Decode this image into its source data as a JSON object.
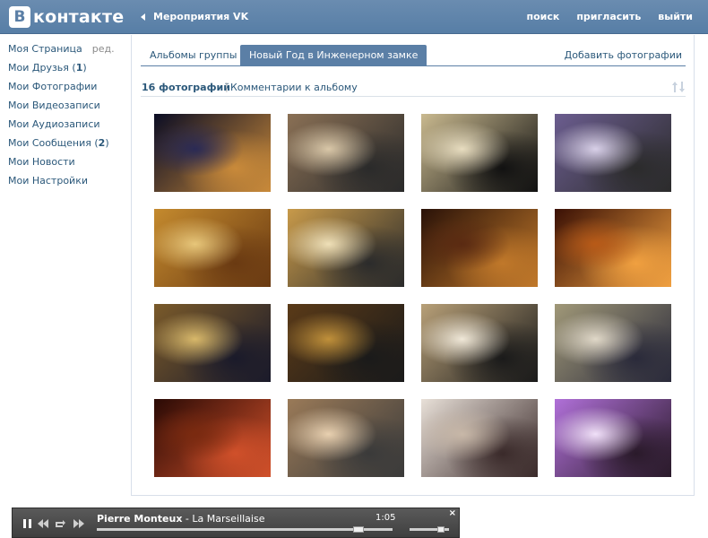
{
  "header": {
    "logo_letter": "B",
    "logo_text": "контакте",
    "back_label": "Мероприятия VK",
    "nav": [
      "поиск",
      "пригласить",
      "выйти"
    ]
  },
  "sidebar": {
    "items": [
      {
        "label": "Моя Страница",
        "extra": "ред."
      },
      {
        "label": "Мои Друзья (",
        "count": "1",
        "suffix": ")"
      },
      {
        "label": "Мои Фотографии"
      },
      {
        "label": "Мои Видеозаписи"
      },
      {
        "label": "Мои Аудиозаписи"
      },
      {
        "label": "Мои Сообщения (",
        "count": "2",
        "suffix": ")"
      },
      {
        "label": "Мои Новости"
      },
      {
        "label": "Мои Настройки"
      }
    ]
  },
  "tabs": {
    "albums": "Альбомы группы",
    "active": "Новый Год в Инженерном замке",
    "add": "Добавить фотографии"
  },
  "album": {
    "count_label": "16 фотографий",
    "separator": "|",
    "comments_label": "Комментарии к альбому"
  },
  "photos": [
    {
      "colors": [
        "#0b0d24",
        "#2a2a55",
        "#c98a3a"
      ]
    },
    {
      "colors": [
        "#8a7055",
        "#d9c7a8",
        "#2a2a2a"
      ]
    },
    {
      "colors": [
        "#c9b98f",
        "#e8ddc0",
        "#111111"
      ]
    },
    {
      "colors": [
        "#6b5d8f",
        "#d8d0e8",
        "#2b2b2b"
      ]
    },
    {
      "colors": [
        "#c48a2e",
        "#e7c67a",
        "#6a3a12"
      ]
    },
    {
      "colors": [
        "#c89a4a",
        "#efe0b8",
        "#2b2b2b"
      ]
    },
    {
      "colors": [
        "#2a1208",
        "#5a2a12",
        "#c0782a"
      ]
    },
    {
      "colors": [
        "#3a1005",
        "#b85a18",
        "#f0a040"
      ]
    },
    {
      "colors": [
        "#7a5a2a",
        "#d8b86a",
        "#1a1a2a"
      ]
    },
    {
      "colors": [
        "#5a3a18",
        "#c0903a",
        "#1a1a1a"
      ]
    },
    {
      "colors": [
        "#b8a078",
        "#f0e8d8",
        "#1a1a1a"
      ]
    },
    {
      "colors": [
        "#a09878",
        "#e0d8c8",
        "#2a2a3a"
      ]
    },
    {
      "colors": [
        "#2a0a05",
        "#7a2a10",
        "#d0502a"
      ]
    },
    {
      "colors": [
        "#9a7a58",
        "#e8d0b0",
        "#3a3a3a"
      ]
    },
    {
      "colors": [
        "#e8e0d8",
        "#c8b8a8",
        "#3a2a2a"
      ]
    },
    {
      "colors": [
        "#b070d8",
        "#f0e0f8",
        "#2a1a2a"
      ]
    }
  ],
  "player": {
    "artist": "Pierre Monteux",
    "title_sep": " - ",
    "title": "La Marseillaise",
    "time": "1:05",
    "progress": 0.9,
    "volume": 0.85,
    "close": "×"
  }
}
